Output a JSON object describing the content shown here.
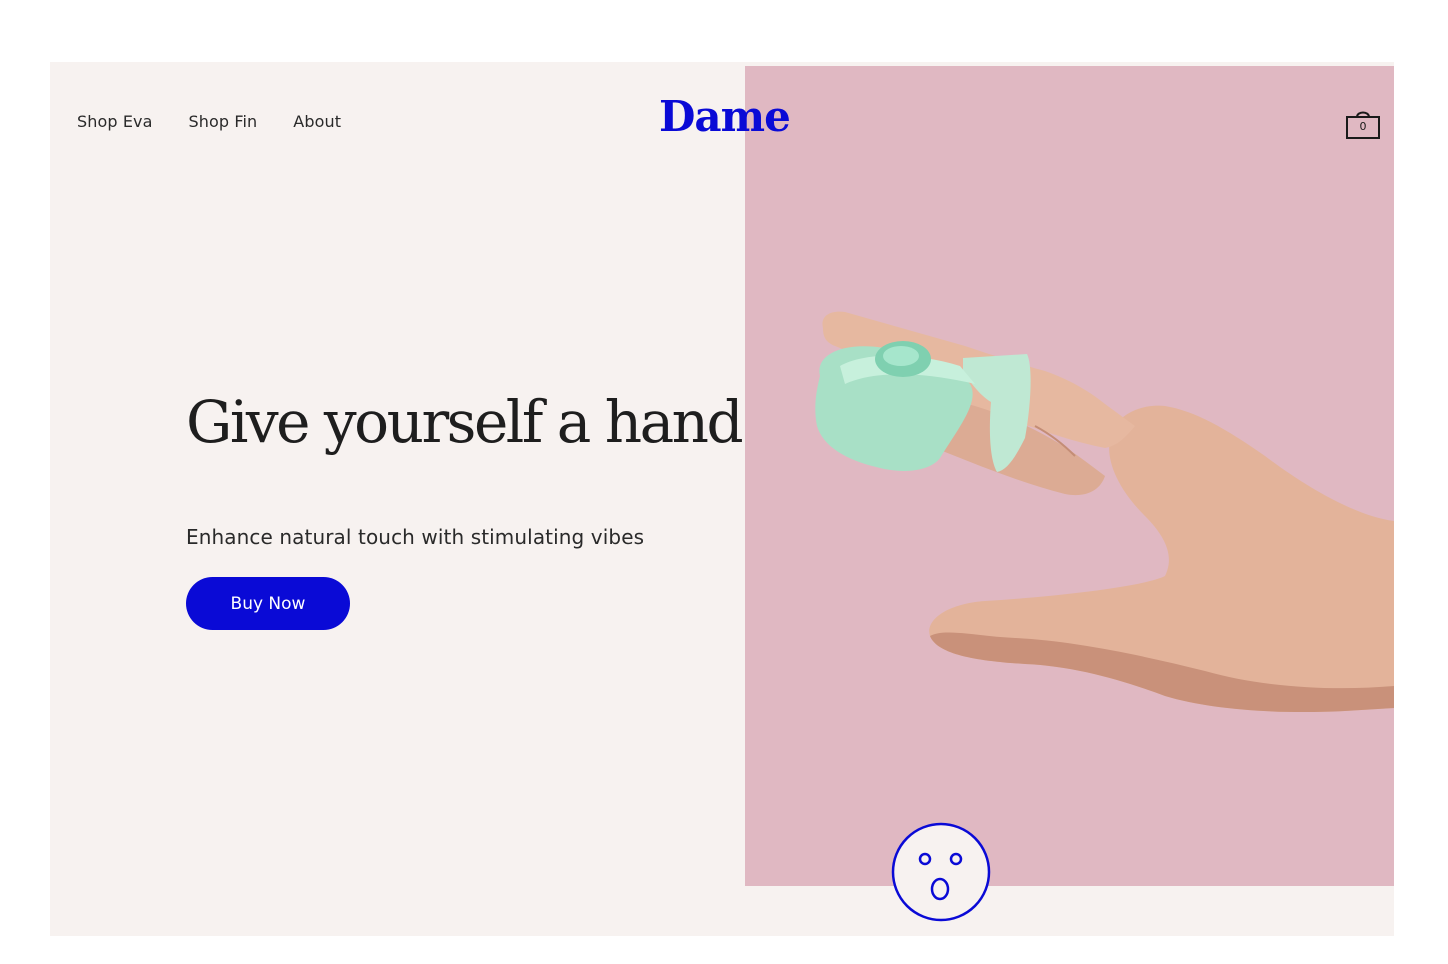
{
  "nav": {
    "items": [
      {
        "label": "Shop Eva"
      },
      {
        "label": "Shop Fin"
      },
      {
        "label": "About"
      }
    ]
  },
  "brand": {
    "logo_text": "Dame",
    "color": "#0a0ad6"
  },
  "cart": {
    "icon": "shopping-bag-icon",
    "count": "0"
  },
  "hero": {
    "title": "Give yourself a hand",
    "subtitle": "Enhance natural touch with stimulating vibes",
    "cta_label": "Buy Now",
    "panel_color": "#e0b8c2",
    "background_color": "#f7f2f0"
  },
  "chat_widget": {
    "icon": "surprised-face-icon"
  }
}
